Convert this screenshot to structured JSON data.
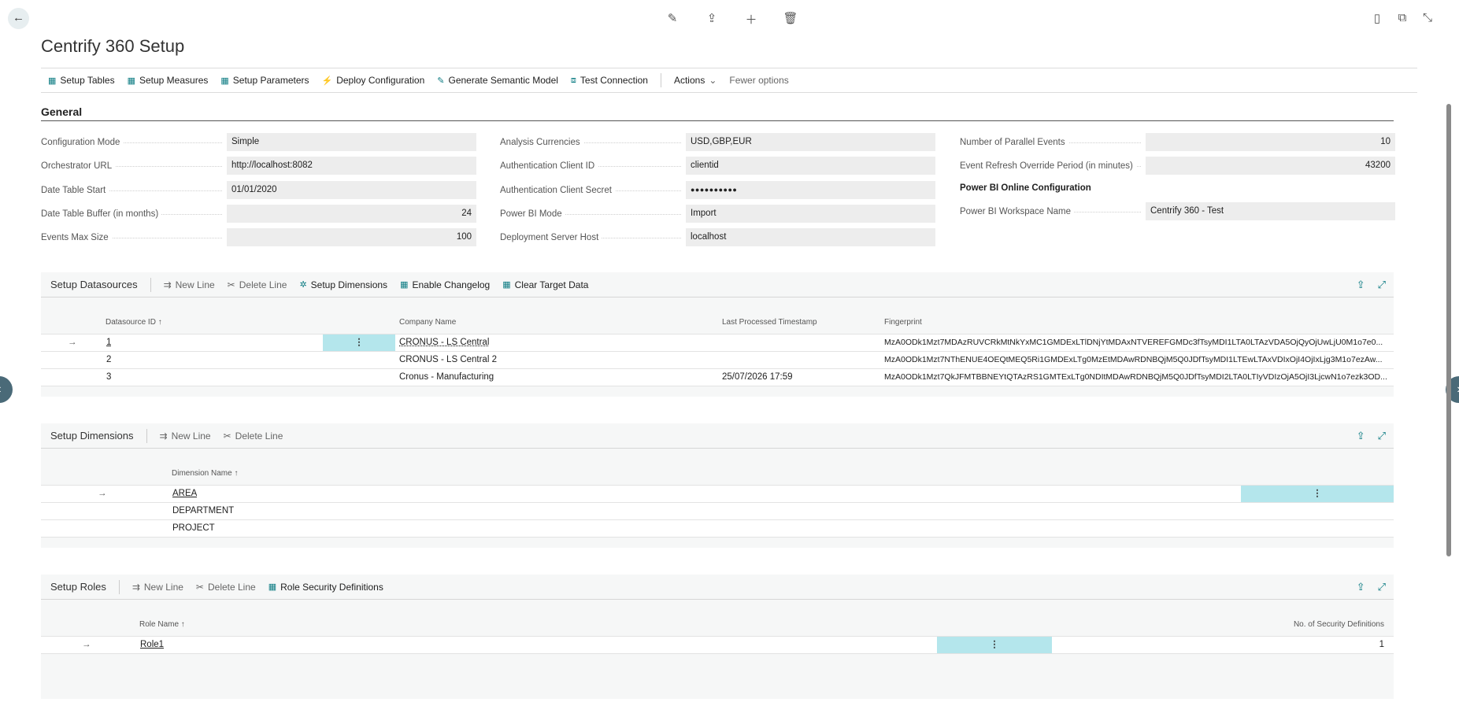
{
  "page": {
    "title": "Centrify 360 Setup"
  },
  "top_icons": [
    "pencil-icon",
    "share-icon",
    "plus-icon",
    "trash-icon"
  ],
  "right_icons": [
    "bookmark-icon",
    "open-new-window-icon",
    "collapse-icon"
  ],
  "actions": [
    {
      "label": "Setup Tables",
      "icon": "table-icon"
    },
    {
      "label": "Setup Measures",
      "icon": "table-icon"
    },
    {
      "label": "Setup Parameters",
      "icon": "table-icon"
    },
    {
      "label": "Deploy Configuration",
      "icon": "deploy-icon"
    },
    {
      "label": "Generate Semantic Model",
      "icon": "model-icon"
    },
    {
      "label": "Test Connection",
      "icon": "connection-icon"
    }
  ],
  "actions_menu": "Actions",
  "fewer_options": "Fewer options",
  "general": {
    "heading": "General",
    "col1": [
      {
        "label": "Configuration Mode",
        "value": "Simple"
      },
      {
        "label": "Orchestrator URL",
        "value": "http://localhost:8082"
      },
      {
        "label": "Date Table Start",
        "value": "01/01/2020"
      },
      {
        "label": "Date Table Buffer (in months)",
        "value": "24"
      },
      {
        "label": "Events Max Size",
        "value": "100"
      }
    ],
    "col2": [
      {
        "label": "Analysis Currencies",
        "value": "USD,GBP,EUR"
      },
      {
        "label": "Authentication Client ID",
        "value": "clientid"
      },
      {
        "label": "Authentication Client Secret",
        "value": "●●●●●●●●●●"
      },
      {
        "label": "Power BI Mode",
        "value": "Import"
      },
      {
        "label": "Deployment Server Host",
        "value": "localhost"
      }
    ],
    "col3": [
      {
        "label": "Number of Parallel Events",
        "value": "10"
      },
      {
        "label": "Event Refresh Override Period (in minutes)",
        "value": "43200"
      },
      {
        "label": "Power BI Workspace Name",
        "value": "Centrify 360 - Test"
      }
    ],
    "pbi_header": "Power BI Online Configuration"
  },
  "datasources": {
    "title": "Setup Datasources",
    "tools": [
      "New Line",
      "Delete Line",
      "Setup Dimensions",
      "Enable Changelog",
      "Clear Target Data"
    ],
    "columns": [
      "Datasource ID ↑",
      "Company Name",
      "Last Processed Timestamp",
      "Fingerprint"
    ],
    "rows": [
      {
        "id": "1",
        "company": "CRONUS - LS Central",
        "timestamp": "",
        "fingerprint": "MzA0ODk1Mzt7MDAzRUVCRkMtNkYxMC1GMDExLTlDNjYtMDAxNTVEREFGMDc3fTsyMDI1LTA0LTAzVDA5OjQyOjUwLjU0M1o7e0..."
      },
      {
        "id": "2",
        "company": "CRONUS - LS Central 2",
        "timestamp": "",
        "fingerprint": "MzA0ODk1Mzt7NThENUE4OEQtMEQ5Ri1GMDExLTg0MzEtMDAwRDNBQjM5Q0JDfTsyMDI1LTEwLTAxVDIxOjI4OjIxLjg3M1o7ezAw..."
      },
      {
        "id": "3",
        "company": "Cronus - Manufacturing",
        "timestamp": "25/07/2026 17:59",
        "fingerprint": "MzA0ODk1Mzt7QkJFMTBBNEYtQTAzRS1GMTExLTg0NDItMDAwRDNBQjM5Q0JDfTsyMDI2LTA0LTIyVDIzOjA5OjI3LjcwN1o7ezk3OD..."
      }
    ]
  },
  "dimensions": {
    "title": "Setup Dimensions",
    "tools": [
      "New Line",
      "Delete Line"
    ],
    "column": "Dimension Name ↑",
    "rows": [
      "AREA",
      "DEPARTMENT",
      "PROJECT"
    ]
  },
  "roles": {
    "title": "Setup Roles",
    "tools": [
      "New Line",
      "Delete Line",
      "Role Security Definitions"
    ],
    "columns": [
      "Role Name ↑",
      "No. of Security Definitions"
    ],
    "rows": [
      {
        "name": "Role1",
        "count": "1"
      }
    ]
  },
  "row_arrow": "→",
  "row_menu": "⋮"
}
